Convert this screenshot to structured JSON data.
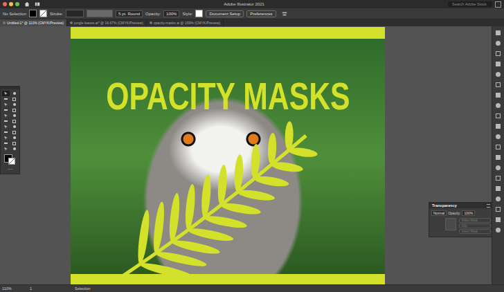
{
  "window": {
    "title": "Adobe Illustrator 2021"
  },
  "search": {
    "placeholder": "Search Adobe Stock"
  },
  "control_bar": {
    "selection": "No Selection",
    "stroke_label": "Stroke:",
    "brush": "5 pt. Round",
    "opacity_label": "Opacity:",
    "opacity": "100%",
    "style_label": "Style:",
    "buttons": [
      "Document Setup",
      "Preferences"
    ]
  },
  "tabs": [
    {
      "label": "Untitled-1* @ 110% (CMYK/Preview)",
      "selected": true
    },
    {
      "label": "jungle-leaves.ai* @ 16.67% (CMYK/Preview)",
      "selected": false
    },
    {
      "label": "opacity-masks.ai @ 159% (CMYK/Preview)",
      "selected": false
    }
  ],
  "tools": [
    {
      "selected": true
    },
    {
      "selected": false
    },
    {
      "selected": false
    },
    {
      "selected": false
    },
    {
      "selected": false
    },
    {
      "selected": false
    },
    {
      "selected": false
    },
    {
      "selected": false
    },
    {
      "selected": false
    },
    {
      "selected": false
    },
    {
      "selected": false
    },
    {
      "selected": false
    },
    {
      "selected": false
    },
    {
      "selected": false
    },
    {
      "selected": false
    },
    {
      "selected": false
    },
    {
      "selected": false
    },
    {
      "selected": false
    },
    {
      "selected": false
    },
    {
      "selected": false
    },
    {
      "selected": false
    },
    {
      "selected": false
    }
  ],
  "artboard": {
    "headline": "OPACITY MASKS"
  },
  "transparency_panel": {
    "title": "Transparency",
    "blend_mode": "Normal",
    "opacity_label": "Opacity:",
    "opacity": "100%",
    "buttons": [
      {
        "label": "Make Mask",
        "disabled": true
      },
      {
        "label": "Clip",
        "disabled": true
      },
      {
        "label": "Invert Mask",
        "disabled": true
      }
    ]
  },
  "status_bar": {
    "zoom": "110%",
    "artboard": "1",
    "tool": "Selection"
  }
}
